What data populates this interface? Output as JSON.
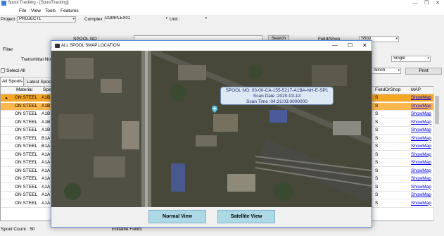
{
  "window": {
    "title": "Spool Tracking - [SpoolTracking]",
    "minimize": "—",
    "maximize": "❐",
    "close": "✕"
  },
  "menu": [
    "File",
    "View",
    "Tools",
    "Features"
  ],
  "filters": {
    "project_label": "Project :",
    "project_value": "PROJECT1",
    "complex_label": "Complex :",
    "complex_value": "COMPLEX01",
    "unit_label": "Unit :",
    "unit_value": ""
  },
  "search": {
    "spool_no_label": "SPOOL NO :",
    "search_button": "Search",
    "fieldshop_label": "Field/Shop",
    "fieldshop_value": "Shop",
    "filter_label": "Filter",
    "transmittal_label": "Transmittal No",
    "single_value": "Single",
    "spool_mode_value": "Allnch",
    "print_button": "Print",
    "select_all_label": "Select All"
  },
  "tabs": [
    "All Spools",
    "Latest Spools"
  ],
  "grid": {
    "columns": [
      "Material",
      "Spe",
      "FieldOrShop",
      "MAP"
    ],
    "material_values": [
      "ON STEEL",
      "ON STEEL",
      "ON STEEL",
      "ON STEEL",
      "ON STEEL",
      "ON STEEL",
      "ON STEEL",
      "ON STEEL",
      "ON STEEL",
      "ON STEEL",
      "ON STEEL",
      "ON STEEL",
      "ON STEEL",
      "ON STEEL"
    ],
    "spec_values": [
      "A1B",
      "A1B",
      "A1B",
      "A1B",
      "A1B",
      "B1A",
      "B1A",
      "A1A",
      "A1A",
      "A1A",
      "A1A",
      "A1A",
      "A1A",
      "A1A"
    ],
    "fieldshop_values": [
      "S",
      "S",
      "S",
      "S",
      "S",
      "S",
      "S",
      "S",
      "S",
      "S",
      "S",
      "S",
      "S",
      "S"
    ],
    "map_link": "ShowMap"
  },
  "status": {
    "spool_count": "Spool Count : 50",
    "editable_fields": "Editable Fields"
  },
  "colors": {
    "selected_row": "#f5a623",
    "highlight_row": "#ffb84d",
    "link": "#0000ee"
  },
  "dialog": {
    "title": "ALL SPOOL SMAP LOCATION",
    "popup_line1": "SPOOL NO: 03-00-CA-155-5217-A1BA-NH-E-SP1",
    "popup_line2": "Scan Date :2020-03-13",
    "popup_line3": "Scan Time :04:31:03.0000000",
    "normal_view": "Normal View",
    "satellite_view": "Satellite View",
    "minimize": "—",
    "maximize": "☐",
    "close": "✕"
  }
}
